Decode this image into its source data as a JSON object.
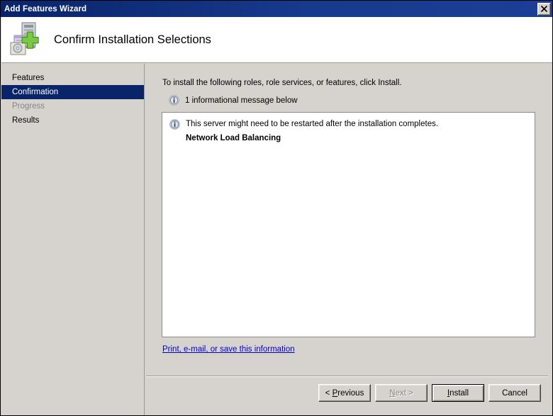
{
  "window": {
    "title": "Add Features Wizard",
    "close_icon": "close-icon",
    "close_glyph": "X"
  },
  "banner": {
    "icon": "add-features-server-icon",
    "title": "Confirm Installation Selections"
  },
  "sidebar": {
    "items": [
      {
        "label": "Features",
        "state": "normal",
        "name": "sidebar-item-features"
      },
      {
        "label": "Confirmation",
        "state": "selected",
        "name": "sidebar-item-confirmation"
      },
      {
        "label": "Progress",
        "state": "disabled",
        "name": "sidebar-item-progress"
      },
      {
        "label": "Results",
        "state": "normal",
        "name": "sidebar-item-results"
      }
    ]
  },
  "main": {
    "intro": "To install the following roles, role services, or features, click Install.",
    "message_summary": "1 informational message below",
    "message_summary_icon": "information-icon",
    "listbox": {
      "message_icon": "information-icon",
      "message": "This server might need to be restarted after the installation completes.",
      "feature": "Network Load Balancing"
    },
    "print_link": "Print, e-mail, or save this information"
  },
  "footer": {
    "buttons": [
      {
        "label_prefix": "< ",
        "accel": "P",
        "label_suffix": "revious",
        "state": "enabled",
        "name": "previous-button"
      },
      {
        "label_prefix": "",
        "accel": "N",
        "label_suffix": "ext >",
        "state": "disabled",
        "name": "next-button"
      },
      {
        "label_prefix": "",
        "accel": "I",
        "label_suffix": "nstall",
        "state": "default",
        "name": "install-button"
      },
      {
        "label_prefix": "",
        "accel": "",
        "label_suffix": "Cancel",
        "state": "enabled",
        "name": "cancel-button"
      }
    ]
  },
  "colors": {
    "titlebar": "#0a246a",
    "face": "#d6d3ce",
    "selection": "#0a246a",
    "link": "#0000cc",
    "disabled_text": "#868686"
  }
}
